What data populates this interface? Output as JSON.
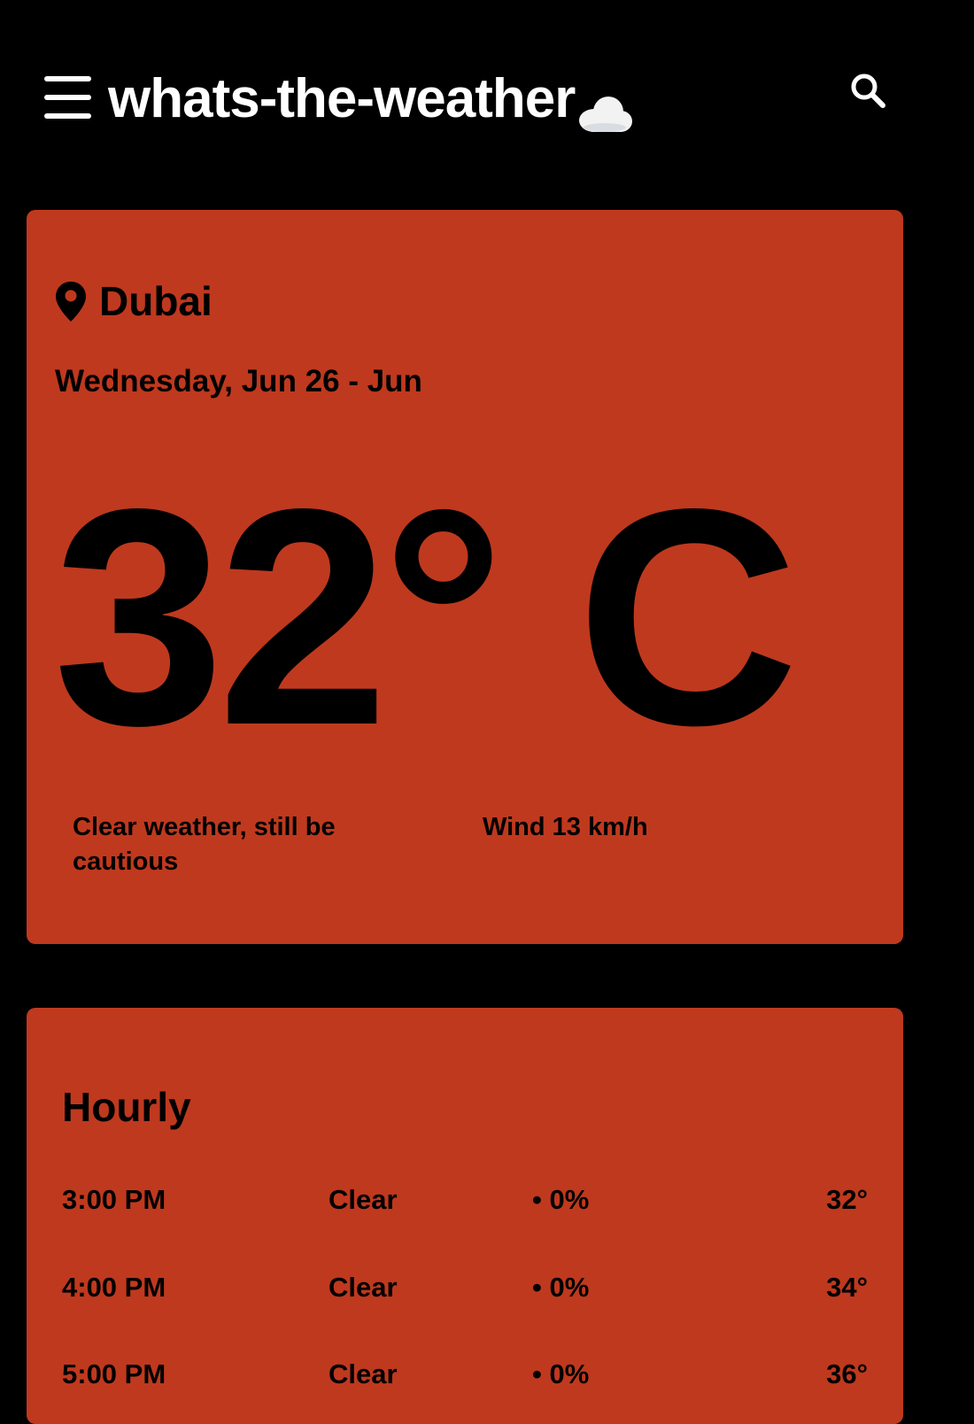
{
  "header": {
    "app_title": "whats-the-weather",
    "title_icon": "cloud-icon",
    "menu_icon": "hamburger-menu-icon",
    "search_icon": "search-icon"
  },
  "current": {
    "location_icon": "map-pin-icon",
    "city": "Dubai",
    "date": "Wednesday, Jun 26 - Jun",
    "temperature": "32° C",
    "description": "Clear weather, still be cautious",
    "wind": "Wind 13 km/h"
  },
  "hourly": {
    "title": "Hourly",
    "rows": [
      {
        "time": "3:00 PM",
        "condition": "Clear",
        "precip": "• 0%",
        "temp": "32°"
      },
      {
        "time": "4:00 PM",
        "condition": "Clear",
        "precip": "• 0%",
        "temp": "34°"
      },
      {
        "time": "5:00 PM",
        "condition": "Clear",
        "precip": "• 0%",
        "temp": "36°"
      }
    ]
  },
  "colors": {
    "background": "#000000",
    "card": "#bf391e",
    "text_on_card": "#000000",
    "header_text": "#ffffff"
  }
}
